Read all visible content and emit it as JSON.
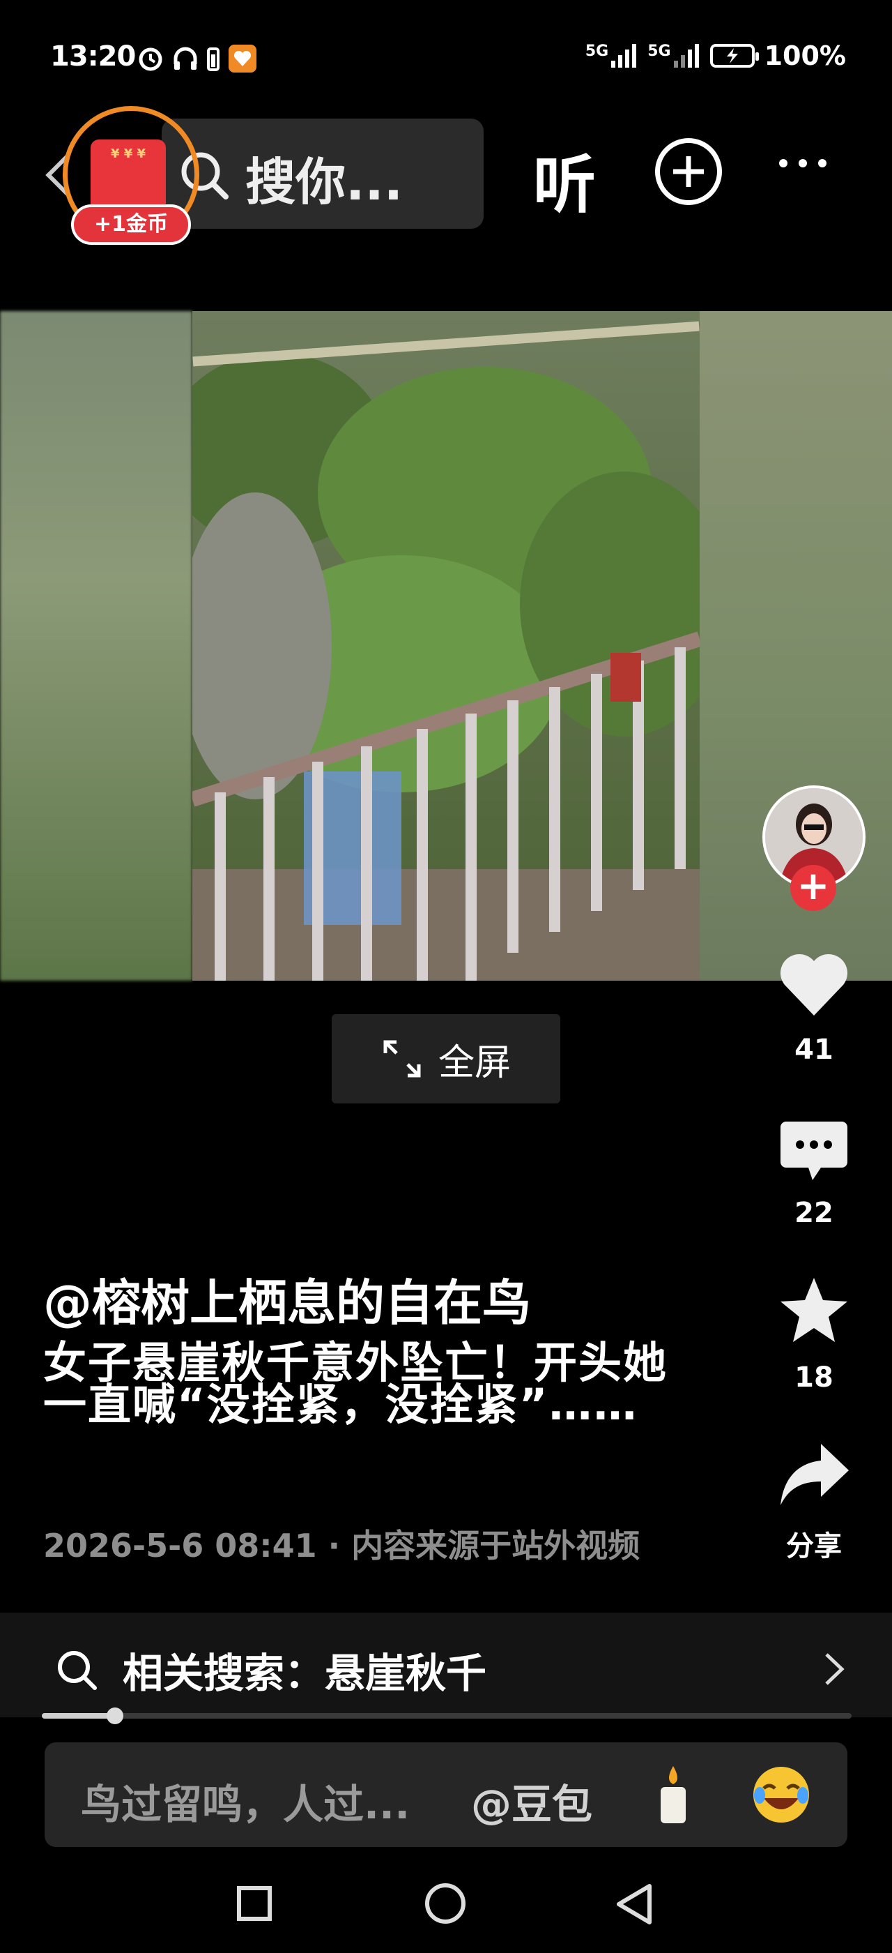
{
  "status_bar": {
    "time": "13:20",
    "network1": "5G",
    "network2": "5G",
    "battery": "100%"
  },
  "top_bar": {
    "search_placeholder": "搜你...",
    "listen_label": "听",
    "coin_reward": "+1金币"
  },
  "video": {
    "fullscreen_label": "全屏"
  },
  "actions": {
    "likes": "41",
    "comments": "22",
    "favorites": "18",
    "share_label": "分享"
  },
  "post": {
    "author": "@榕树上栖息的自在鸟",
    "description": "女子悬崖秋千意外坠亡！开头她一直喊“没拴紧，没拴紧”……",
    "meta": "2026-5-6 08:41 · 内容来源于站外视频"
  },
  "related_search": {
    "label": "相关搜索：悬崖秋千"
  },
  "playback": {
    "progress": 0.09
  },
  "comment_bar": {
    "placeholder": "鸟过留鸣，人过...",
    "mention": "@豆包"
  },
  "colors": {
    "accent_red": "#e8343b",
    "coin_ring": "#f08a24",
    "background": "#000000"
  }
}
